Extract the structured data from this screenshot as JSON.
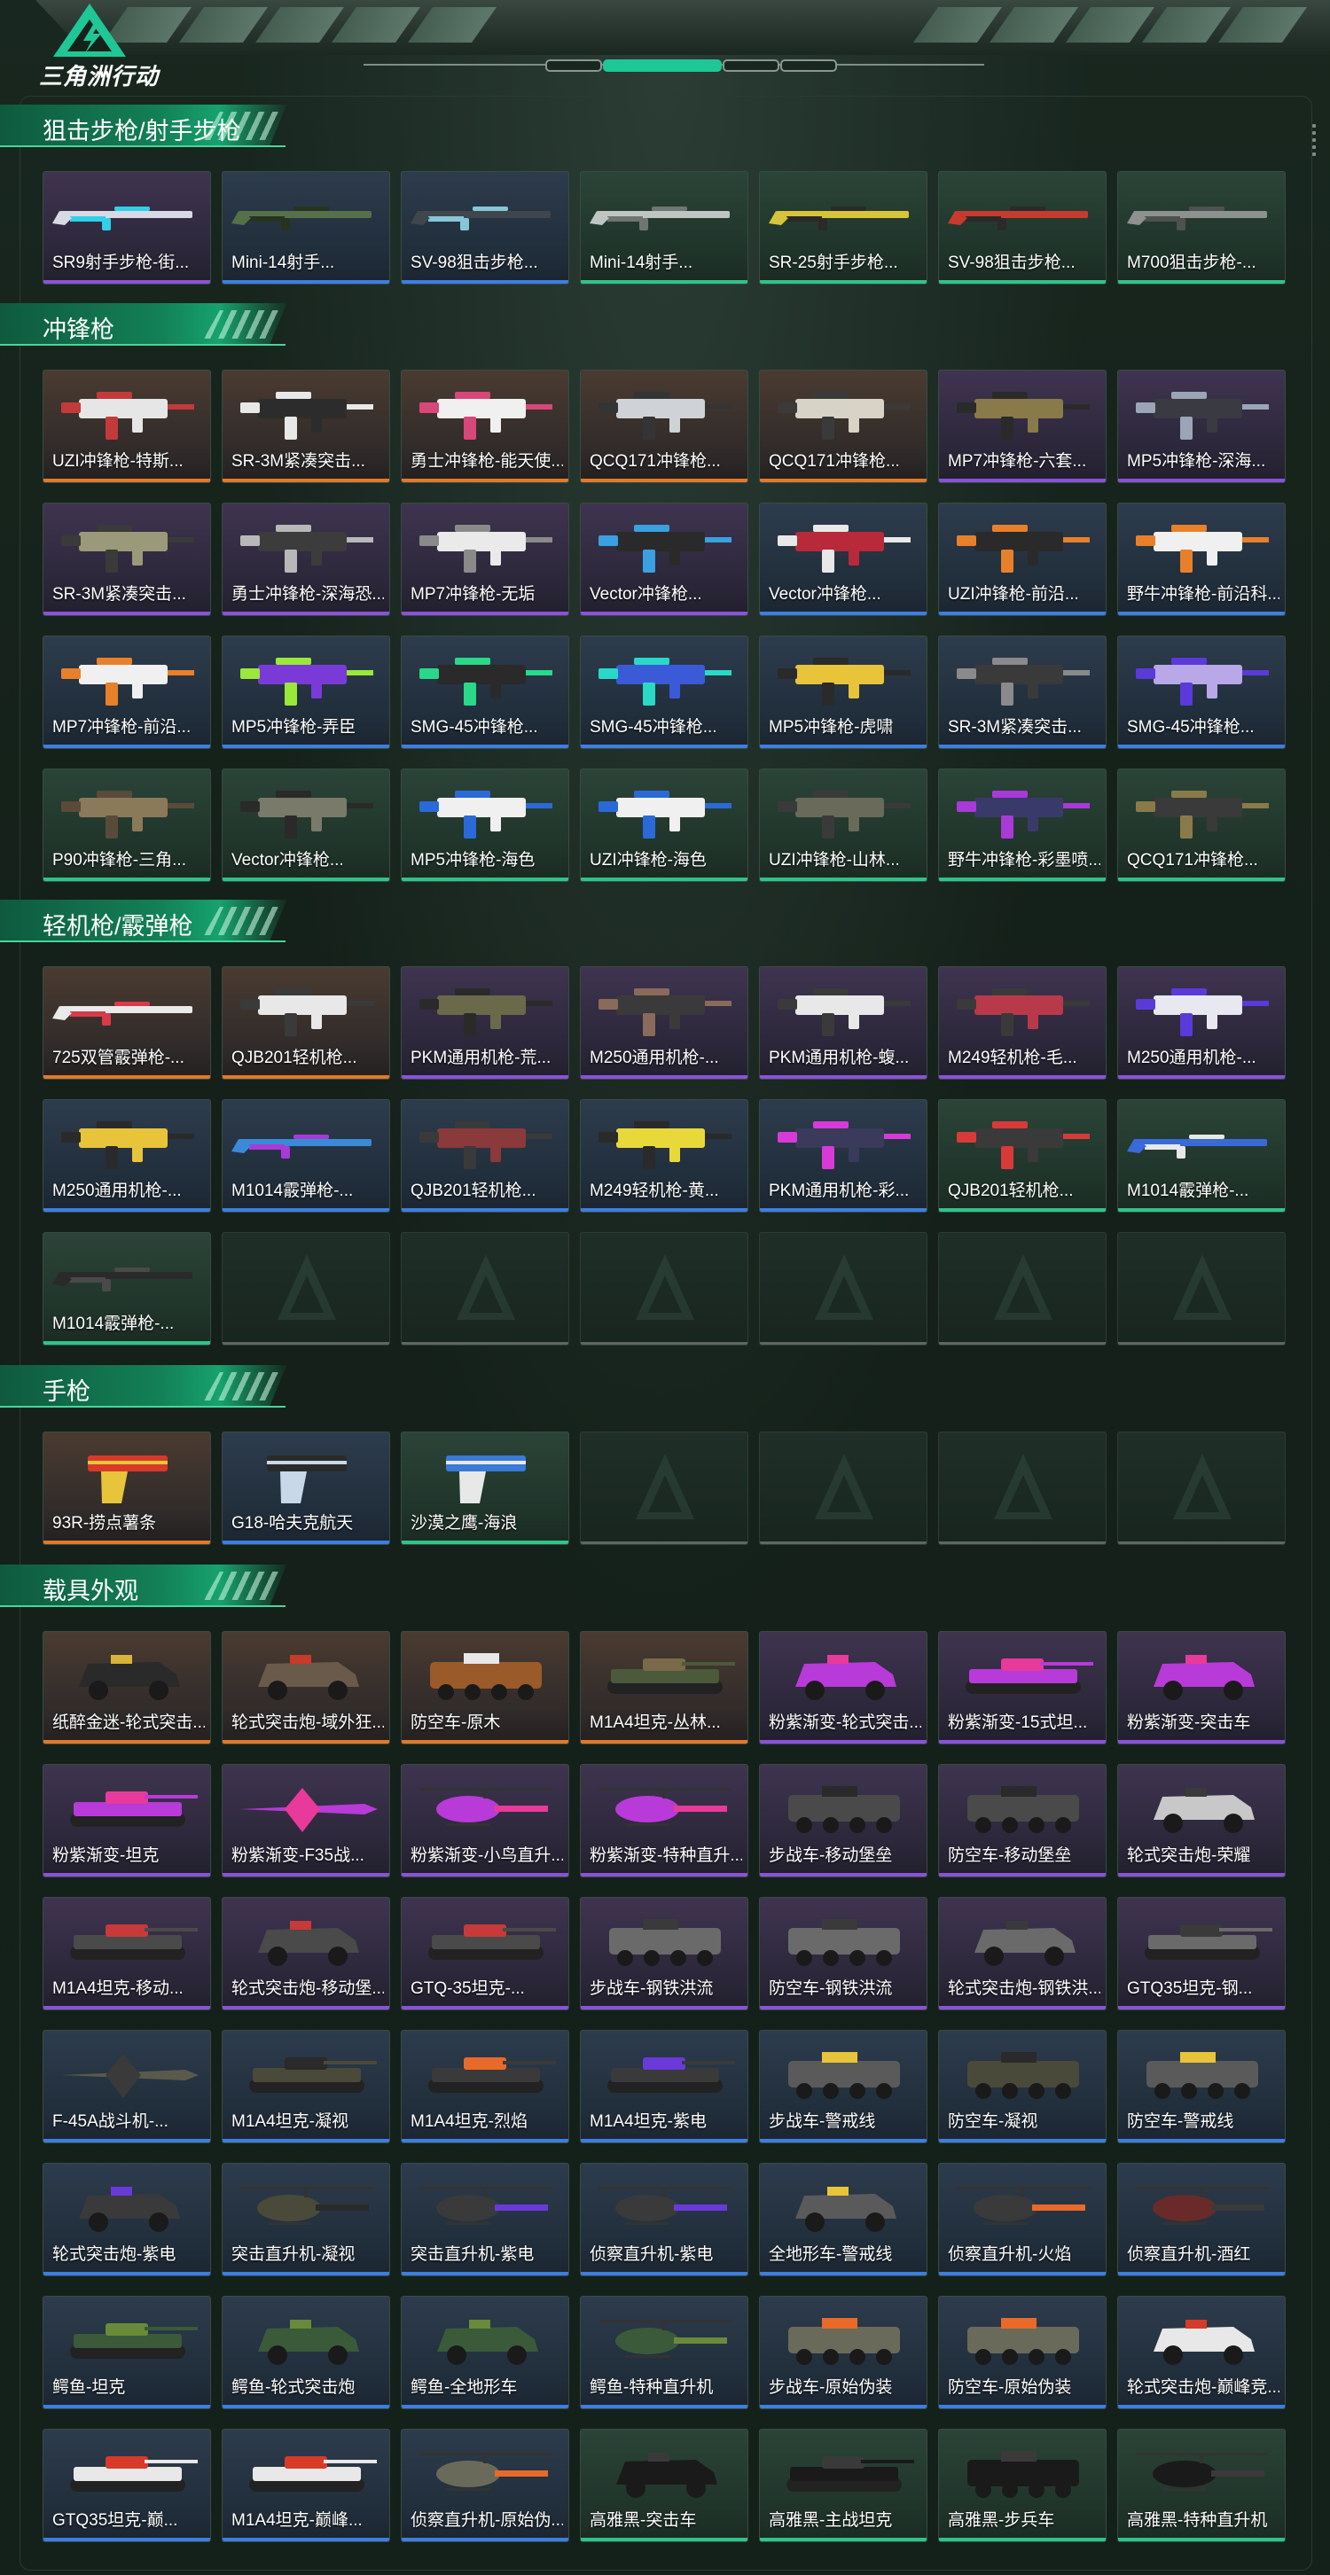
{
  "app": {
    "logo_text": "三角洲行动"
  },
  "colors": {
    "accent": "#1fc796",
    "rarity_orange": "#e07a2a",
    "rarity_purple": "#8a52d8",
    "rarity_blue": "#3b7fe0",
    "rarity_green": "#2fc488",
    "empty_slot": "#5d6763"
  },
  "sections": [
    {
      "title": "狙击步枪/射手步枪",
      "icon": "rifle",
      "items": [
        {
          "label": "SR9射手步枪-街...",
          "rarity": "purple",
          "type": "rifle",
          "color": "#d9d9e6",
          "accent_color": "#2fd1e8"
        },
        {
          "label": "Mini-14射手...",
          "rarity": "blue",
          "type": "rifle",
          "color": "#55704a",
          "accent_color": "#27331f"
        },
        {
          "label": "SV-98狙击步枪...",
          "rarity": "blue",
          "type": "rifle",
          "color": "#40464e",
          "accent_color": "#87c6d8"
        },
        {
          "label": "Mini-14射手...",
          "rarity": "green",
          "type": "rifle",
          "color": "#bfc5c3",
          "accent_color": "#6f7572"
        },
        {
          "label": "SR-25射手步枪...",
          "rarity": "green",
          "type": "rifle",
          "color": "#d8c43a",
          "accent_color": "#2a2a2a"
        },
        {
          "label": "SV-98狙击步枪...",
          "rarity": "green",
          "type": "rifle",
          "color": "#c63b2e",
          "accent_color": "#2a2a2a"
        },
        {
          "label": "M700狙击步枪-...",
          "rarity": "green",
          "type": "rifle",
          "color": "#8d918f",
          "accent_color": "#4d514f"
        }
      ]
    },
    {
      "title": "冲锋枪",
      "icon": "smg",
      "items": [
        {
          "label": "UZI冲锋枪-特斯...",
          "rarity": "orange",
          "type": "smg",
          "color": "#e6e6e6",
          "accent_color": "#c23a3a"
        },
        {
          "label": "SR-3M紧凑突击...",
          "rarity": "orange",
          "type": "smg",
          "color": "#2c2c2c",
          "accent_color": "#e8e8e8"
        },
        {
          "label": "勇士冲锋枪-能天使...",
          "rarity": "orange",
          "type": "smg",
          "color": "#f0f0f0",
          "accent_color": "#d8477a"
        },
        {
          "label": "QCQ171冲锋枪...",
          "rarity": "orange",
          "type": "smg",
          "color": "#cfd2d6",
          "accent_color": "#343434"
        },
        {
          "label": "QCQ171冲锋枪...",
          "rarity": "orange",
          "type": "smg",
          "color": "#d7d3c6",
          "accent_color": "#3a3a3a"
        },
        {
          "label": "MP7冲锋枪-六套...",
          "rarity": "purple",
          "type": "smg",
          "color": "#8a7a4a",
          "accent_color": "#2a2a2a"
        },
        {
          "label": "MP5冲锋枪-深海...",
          "rarity": "purple",
          "type": "smg",
          "color": "#3a3a42",
          "accent_color": "#9aa6b8"
        },
        {
          "label": "SR-3M紧凑突击...",
          "rarity": "purple",
          "type": "smg",
          "color": "#9a9a7a",
          "accent_color": "#3a3a3a"
        },
        {
          "label": "勇士冲锋枪-深海恐...",
          "rarity": "purple",
          "type": "smg",
          "color": "#3c3c3c",
          "accent_color": "#b8b8b8"
        },
        {
          "label": "MP7冲锋枪-无垢",
          "rarity": "purple",
          "type": "smg",
          "color": "#eaeaea",
          "accent_color": "#8a8a8a"
        },
        {
          "label": "Vector冲锋枪...",
          "rarity": "purple",
          "type": "smg",
          "color": "#2a2a2a",
          "accent_color": "#3aa0e0"
        },
        {
          "label": "Vector冲锋枪...",
          "rarity": "blue",
          "type": "smg",
          "color": "#b82a3a",
          "accent_color": "#e8e8e8"
        },
        {
          "label": "UZI冲锋枪-前沿...",
          "rarity": "blue",
          "type": "smg",
          "color": "#2a2a2a",
          "accent_color": "#e8802a"
        },
        {
          "label": "野牛冲锋枪-前沿科...",
          "rarity": "blue",
          "type": "smg",
          "color": "#f0f0f0",
          "accent_color": "#e8802a"
        },
        {
          "label": "MP7冲锋枪-前沿...",
          "rarity": "blue",
          "type": "smg",
          "color": "#f0f0f0",
          "accent_color": "#e8802a"
        },
        {
          "label": "MP5冲锋枪-弄臣",
          "rarity": "blue",
          "type": "smg",
          "color": "#7a3ad8",
          "accent_color": "#9ae83a"
        },
        {
          "label": "SMG-45冲锋枪...",
          "rarity": "blue",
          "type": "smg",
          "color": "#2a2a2a",
          "accent_color": "#2ad88a"
        },
        {
          "label": "SMG-45冲锋枪...",
          "rarity": "blue",
          "type": "smg",
          "color": "#3a5ad8",
          "accent_color": "#2ad8c8"
        },
        {
          "label": "MP5冲锋枪-虎啸",
          "rarity": "blue",
          "type": "smg",
          "color": "#e8c43a",
          "accent_color": "#2a2a2a"
        },
        {
          "label": "SR-3M紧凑突击...",
          "rarity": "blue",
          "type": "smg",
          "color": "#3a3a3a",
          "accent_color": "#8a8a8a"
        },
        {
          "label": "SMG-45冲锋枪...",
          "rarity": "blue",
          "type": "smg",
          "color": "#b8a8e8",
          "accent_color": "#5a3ad8"
        },
        {
          "label": "P90冲锋枪-三角...",
          "rarity": "green",
          "type": "smg",
          "color": "#8a7a5a",
          "accent_color": "#5a4a3a"
        },
        {
          "label": "Vector冲锋枪...",
          "rarity": "green",
          "type": "smg",
          "color": "#7a7a6a",
          "accent_color": "#2a2a2a"
        },
        {
          "label": "MP5冲锋枪-海色",
          "rarity": "green",
          "type": "smg",
          "color": "#f0f0f0",
          "accent_color": "#2a6ad8"
        },
        {
          "label": "UZI冲锋枪-海色",
          "rarity": "green",
          "type": "smg",
          "color": "#f0f0f0",
          "accent_color": "#2a6ad8"
        },
        {
          "label": "UZI冲锋枪-山林...",
          "rarity": "green",
          "type": "smg",
          "color": "#6a6a5a",
          "accent_color": "#3a3a3a"
        },
        {
          "label": "野牛冲锋枪-彩墨喷...",
          "rarity": "green",
          "type": "smg",
          "color": "#3a3a6a",
          "accent_color": "#a83ad8"
        },
        {
          "label": "QCQ171冲锋枪...",
          "rarity": "green",
          "type": "smg",
          "color": "#3a3a3a",
          "accent_color": "#8a7a4a"
        }
      ]
    },
    {
      "title": "轻机枪/霰弹枪",
      "icon": "lmg",
      "items": [
        {
          "label": "725双管霰弹枪-...",
          "rarity": "orange",
          "type": "shotgun",
          "color": "#eaeaea",
          "accent_color": "#d83a4a"
        },
        {
          "label": "QJB201轻机枪...",
          "rarity": "orange",
          "type": "lmg",
          "color": "#e8e8e8",
          "accent_color": "#3a3a3a"
        },
        {
          "label": "PKM通用机枪-荒...",
          "rarity": "purple",
          "type": "lmg",
          "color": "#6a6a4a",
          "accent_color": "#2a2a2a"
        },
        {
          "label": "M250通用机枪-...",
          "rarity": "purple",
          "type": "lmg",
          "color": "#3a3a3a",
          "accent_color": "#8a6a5a"
        },
        {
          "label": "PKM通用机枪-蝮...",
          "rarity": "purple",
          "type": "lmg",
          "color": "#e8e8e8",
          "accent_color": "#3a3a3a"
        },
        {
          "label": "M249轻机枪-毛...",
          "rarity": "purple",
          "type": "lmg",
          "color": "#b83a4a",
          "accent_color": "#3a3a3a"
        },
        {
          "label": "M250通用机枪-...",
          "rarity": "purple",
          "type": "lmg",
          "color": "#e8e8f0",
          "accent_color": "#5a3ad8"
        },
        {
          "label": "M250通用机枪-...",
          "rarity": "blue",
          "type": "lmg",
          "color": "#e8c43a",
          "accent_color": "#2a2a2a"
        },
        {
          "label": "M1014霰弹枪-...",
          "rarity": "blue",
          "type": "shotgun",
          "color": "#3a8ad8",
          "accent_color": "#a83ad8"
        },
        {
          "label": "QJB201轻机枪...",
          "rarity": "blue",
          "type": "lmg",
          "color": "#8a3a3a",
          "accent_color": "#3a3a3a"
        },
        {
          "label": "M249轻机枪-黄...",
          "rarity": "blue",
          "type": "lmg",
          "color": "#e8d83a",
          "accent_color": "#2a2a2a"
        },
        {
          "label": "PKM通用机枪-彩...",
          "rarity": "blue",
          "type": "lmg",
          "color": "#3a3a5a",
          "accent_color": "#d83ad8"
        },
        {
          "label": "QJB201轻机枪...",
          "rarity": "green",
          "type": "lmg",
          "color": "#3a3a3a",
          "accent_color": "#d83a3a"
        },
        {
          "label": "M1014霰弹枪-...",
          "rarity": "green",
          "type": "shotgun",
          "color": "#3a6ad8",
          "accent_color": "#e8e8e8"
        },
        {
          "label": "M1014霰弹枪-...",
          "rarity": "green",
          "type": "shotgun",
          "color": "#2a2a2a",
          "accent_color": "#4a4a4a"
        },
        {
          "label": "",
          "rarity": "empty"
        },
        {
          "label": "",
          "rarity": "empty"
        },
        {
          "label": "",
          "rarity": "empty"
        },
        {
          "label": "",
          "rarity": "empty"
        },
        {
          "label": "",
          "rarity": "empty"
        },
        {
          "label": "",
          "rarity": "empty"
        }
      ]
    },
    {
      "title": "手枪",
      "icon": "pistol",
      "items": [
        {
          "label": "93R-捞点薯条",
          "rarity": "orange",
          "type": "pistol",
          "color": "#d83a2a",
          "accent_color": "#e8c43a"
        },
        {
          "label": "G18-哈夫克航天",
          "rarity": "blue",
          "type": "pistol",
          "color": "#2a2a2a",
          "accent_color": "#c8d8e8"
        },
        {
          "label": "沙漠之鹰-海浪",
          "rarity": "green",
          "type": "pistol",
          "color": "#3a7ad8",
          "accent_color": "#e8e8e8"
        },
        {
          "label": "",
          "rarity": "empty"
        },
        {
          "label": "",
          "rarity": "empty"
        },
        {
          "label": "",
          "rarity": "empty"
        },
        {
          "label": "",
          "rarity": "empty"
        }
      ]
    },
    {
      "title": "载具外观",
      "icon": "vehicle",
      "items": [
        {
          "label": "纸醉金迷-轮式突击...",
          "rarity": "orange",
          "type": "car",
          "color": "#2a2a2a",
          "accent_color": "#d8b43a"
        },
        {
          "label": "轮式突击炮-域外狂...",
          "rarity": "orange",
          "type": "car",
          "color": "#6a5a4a",
          "accent_color": "#c83a2a"
        },
        {
          "label": "防空车-原木",
          "rarity": "orange",
          "type": "apc",
          "color": "#9a5a2a",
          "accent_color": "#e8e8e8"
        },
        {
          "label": "M1A4坦克-丛林...",
          "rarity": "orange",
          "type": "tank",
          "color": "#4a5a3a",
          "accent_color": "#7a6a4a"
        },
        {
          "label": "粉紫渐变-轮式突击...",
          "rarity": "purple",
          "type": "car",
          "color": "#b83ad8",
          "accent_color": "#e83a9a"
        },
        {
          "label": "粉紫渐变-15式坦...",
          "rarity": "purple",
          "type": "tank",
          "color": "#b83ad8",
          "accent_color": "#e83a9a"
        },
        {
          "label": "粉紫渐变-突击车",
          "rarity": "purple",
          "type": "car",
          "color": "#b83ad8",
          "accent_color": "#e83a9a"
        },
        {
          "label": "粉紫渐变-坦克",
          "rarity": "purple",
          "type": "tank",
          "color": "#b83ad8",
          "accent_color": "#e83a9a"
        },
        {
          "label": "粉紫渐变-F35战...",
          "rarity": "purple",
          "type": "jet",
          "color": "#b83ad8",
          "accent_color": "#e83a9a"
        },
        {
          "label": "粉紫渐变-小鸟直升...",
          "rarity": "purple",
          "type": "heli",
          "color": "#b83ad8",
          "accent_color": "#e83a9a"
        },
        {
          "label": "粉紫渐变-特种直升...",
          "rarity": "purple",
          "type": "heli",
          "color": "#b83ad8",
          "accent_color": "#e83a9a"
        },
        {
          "label": "步战车-移动堡垒",
          "rarity": "purple",
          "type": "apc",
          "color": "#4a4a4a",
          "accent_color": "#2a2a2a"
        },
        {
          "label": "防空车-移动堡垒",
          "rarity": "purple",
          "type": "apc",
          "color": "#4a4a4a",
          "accent_color": "#2a2a2a"
        },
        {
          "label": "轮式突击炮-荣耀",
          "rarity": "purple",
          "type": "car",
          "color": "#c8c8c8",
          "accent_color": "#3a3a3a"
        },
        {
          "label": "M1A4坦克-移动...",
          "rarity": "purple",
          "type": "tank",
          "color": "#4a4a4a",
          "accent_color": "#c83a3a"
        },
        {
          "label": "轮式突击炮-移动堡...",
          "rarity": "purple",
          "type": "car",
          "color": "#4a4a4a",
          "accent_color": "#c83a3a"
        },
        {
          "label": "GTQ-35坦克-...",
          "rarity": "purple",
          "type": "tank",
          "color": "#4a4a4a",
          "accent_color": "#c83a3a"
        },
        {
          "label": "步战车-钢铁洪流",
          "rarity": "purple",
          "type": "apc",
          "color": "#6a6a6a",
          "accent_color": "#3a3a3a"
        },
        {
          "label": "防空车-钢铁洪流",
          "rarity": "purple",
          "type": "apc",
          "color": "#6a6a6a",
          "accent_color": "#3a3a3a"
        },
        {
          "label": "轮式突击炮-钢铁洪...",
          "rarity": "purple",
          "type": "car",
          "color": "#6a6a6a",
          "accent_color": "#3a3a3a"
        },
        {
          "label": "GTQ35坦克-钢...",
          "rarity": "purple",
          "type": "tank",
          "color": "#6a6a6a",
          "accent_color": "#3a3a3a"
        },
        {
          "label": "F-45A战斗机-...",
          "rarity": "blue",
          "type": "jet",
          "color": "#5a5a4a",
          "accent_color": "#3a3a3a"
        },
        {
          "label": "M1A4坦克-凝视",
          "rarity": "blue",
          "type": "tank",
          "color": "#4a4a3a",
          "accent_color": "#2a2a2a"
        },
        {
          "label": "M1A4坦克-烈焰",
          "rarity": "blue",
          "type": "tank",
          "color": "#3a3a3a",
          "accent_color": "#e86a2a"
        },
        {
          "label": "M1A4坦克-紫电",
          "rarity": "blue",
          "type": "tank",
          "color": "#3a3a3a",
          "accent_color": "#6a3ad8"
        },
        {
          "label": "步战车-警戒线",
          "rarity": "blue",
          "type": "apc",
          "color": "#5a5a5a",
          "accent_color": "#e8c43a"
        },
        {
          "label": "防空车-凝视",
          "rarity": "blue",
          "type": "apc",
          "color": "#4a4a3a",
          "accent_color": "#2a2a2a"
        },
        {
          "label": "防空车-警戒线",
          "rarity": "blue",
          "type": "apc",
          "color": "#5a5a5a",
          "accent_color": "#e8c43a"
        },
        {
          "label": "轮式突击炮-紫电",
          "rarity": "blue",
          "type": "car",
          "color": "#3a3a3a",
          "accent_color": "#6a3ad8"
        },
        {
          "label": "突击直升机-凝视",
          "rarity": "blue",
          "type": "heli",
          "color": "#4a4a3a",
          "accent_color": "#2a2a2a"
        },
        {
          "label": "突击直升机-紫电",
          "rarity": "blue",
          "type": "heli",
          "color": "#3a3a3a",
          "accent_color": "#6a3ad8"
        },
        {
          "label": "侦察直升机-紫电",
          "rarity": "blue",
          "type": "heli",
          "color": "#3a3a3a",
          "accent_color": "#6a3ad8"
        },
        {
          "label": "全地形车-警戒线",
          "rarity": "blue",
          "type": "atv",
          "color": "#5a5a5a",
          "accent_color": "#e8c43a"
        },
        {
          "label": "侦察直升机-火焰",
          "rarity": "blue",
          "type": "heli",
          "color": "#3a3a3a",
          "accent_color": "#e86a2a"
        },
        {
          "label": "侦察直升机-酒红",
          "rarity": "blue",
          "type": "heli",
          "color": "#6a2a2a",
          "accent_color": "#3a3a3a"
        },
        {
          "label": "鳄鱼-坦克",
          "rarity": "blue",
          "type": "tank",
          "color": "#3a5a3a",
          "accent_color": "#6a8a3a"
        },
        {
          "label": "鳄鱼-轮式突击炮",
          "rarity": "blue",
          "type": "car",
          "color": "#3a5a3a",
          "accent_color": "#6a8a3a"
        },
        {
          "label": "鳄鱼-全地形车",
          "rarity": "blue",
          "type": "atv",
          "color": "#3a5a3a",
          "accent_color": "#6a8a3a"
        },
        {
          "label": "鳄鱼-特种直升机",
          "rarity": "blue",
          "type": "heli",
          "color": "#3a5a3a",
          "accent_color": "#6a8a3a"
        },
        {
          "label": "步战车-原始伪装",
          "rarity": "blue",
          "type": "apc",
          "color": "#6a6a5a",
          "accent_color": "#e86a2a"
        },
        {
          "label": "防空车-原始伪装",
          "rarity": "blue",
          "type": "apc",
          "color": "#6a6a5a",
          "accent_color": "#e86a2a"
        },
        {
          "label": "轮式突击炮-巅峰竞...",
          "rarity": "blue",
          "type": "car",
          "color": "#e8e8e8",
          "accent_color": "#d83a2a"
        },
        {
          "label": "GTQ35坦克-巅...",
          "rarity": "blue",
          "type": "tank",
          "color": "#e8e8e8",
          "accent_color": "#d83a2a"
        },
        {
          "label": "M1A4坦克-巅峰...",
          "rarity": "blue",
          "type": "tank",
          "color": "#e8e8e8",
          "accent_color": "#d83a2a"
        },
        {
          "label": "侦察直升机-原始伪...",
          "rarity": "blue",
          "type": "heli",
          "color": "#6a6a5a",
          "accent_color": "#e86a2a"
        },
        {
          "label": "高雅黑-突击车",
          "rarity": "green",
          "type": "car",
          "color": "#1a1a1a",
          "accent_color": "#3a3a3a"
        },
        {
          "label": "高雅黑-主战坦克",
          "rarity": "green",
          "type": "tank",
          "color": "#1a1a1a",
          "accent_color": "#3a3a3a"
        },
        {
          "label": "高雅黑-步兵车",
          "rarity": "green",
          "type": "apc",
          "color": "#1a1a1a",
          "accent_color": "#3a3a3a"
        },
        {
          "label": "高雅黑-特种直升机",
          "rarity": "green",
          "type": "heli",
          "color": "#1a1a1a",
          "accent_color": "#3a3a3a"
        }
      ]
    }
  ]
}
